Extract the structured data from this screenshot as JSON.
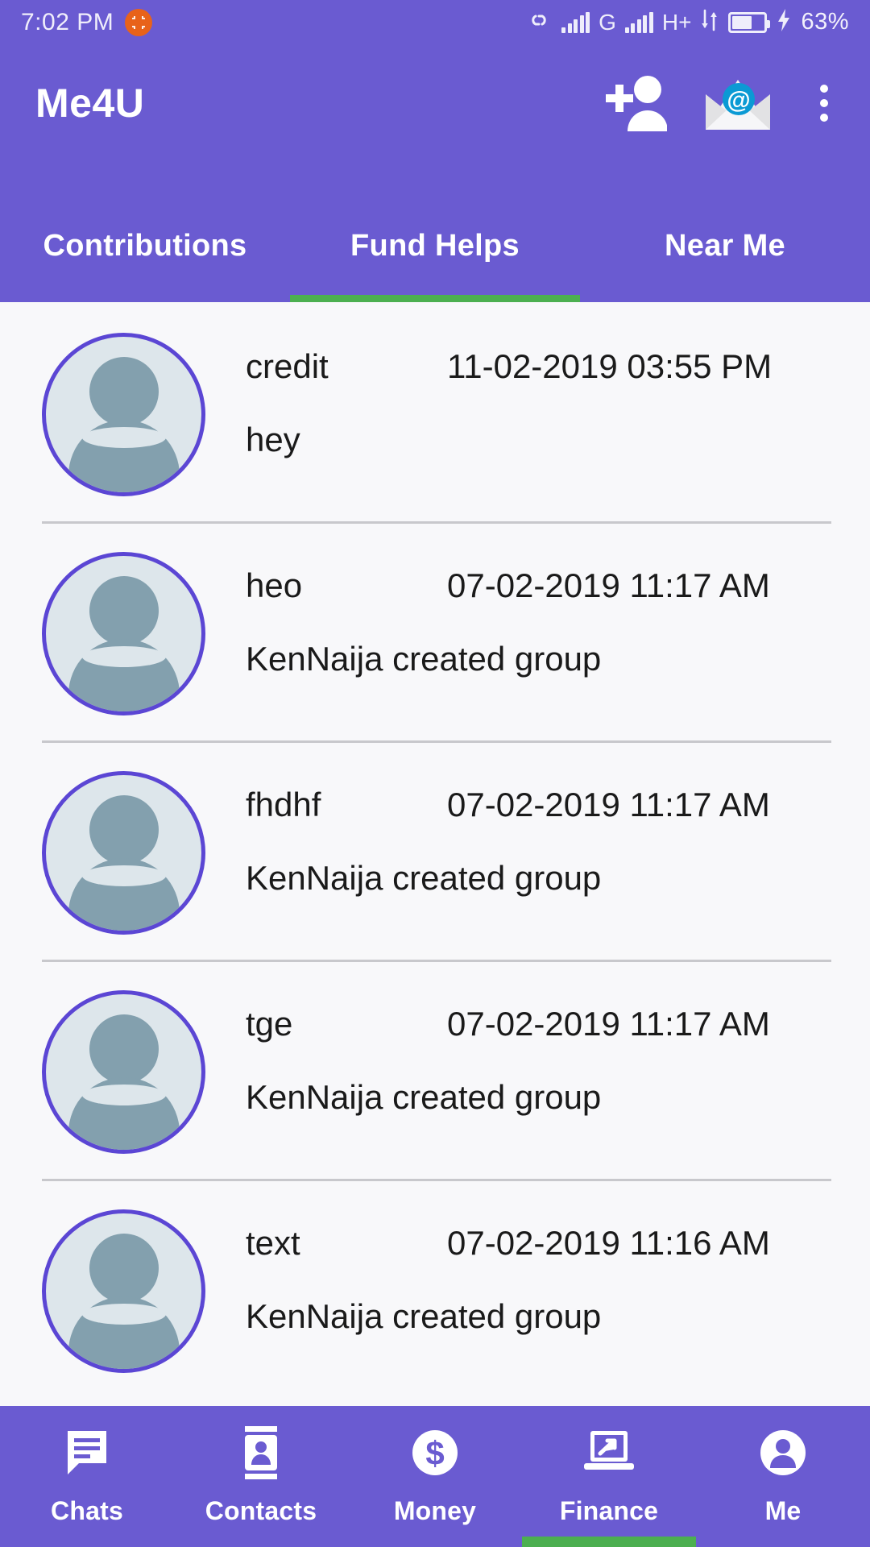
{
  "status_bar": {
    "time": "7:02 PM",
    "capture_icon": "screenshot-capture-icon",
    "link_icon": "chain-link-icon",
    "network_1_icon": "signal-bars-icon",
    "network_label_1": "G",
    "network_2_icon": "signal-bars-icon",
    "network_label_2": "H+",
    "data_transfer_icon": "data-transfer-arrows-icon",
    "battery_icon": "battery-charging-icon",
    "battery_percent": "63%",
    "accent_color": "#6a5bd1"
  },
  "app_bar": {
    "title": "Me4U",
    "add_contact_icon": "add-person-icon",
    "mail_icon": "email-envelope-icon",
    "overflow_icon": "more-vertical-icon"
  },
  "tabs": {
    "items": [
      {
        "label": "Contributions",
        "active": false
      },
      {
        "label": "Fund Helps",
        "active": true
      },
      {
        "label": "Near Me",
        "active": false
      }
    ],
    "indicator_color": "#4caf50"
  },
  "list": {
    "rows": [
      {
        "avatar_icon": "default-user-avatar-icon",
        "name": "credit",
        "timestamp": "11-02-2019 03:55 PM",
        "message": "hey"
      },
      {
        "avatar_icon": "default-user-avatar-icon",
        "name": "heo",
        "timestamp": "07-02-2019 11:17 AM",
        "message": "KenNaija created group"
      },
      {
        "avatar_icon": "default-user-avatar-icon",
        "name": "fhdhf",
        "timestamp": "07-02-2019 11:17 AM",
        "message": "KenNaija created group"
      },
      {
        "avatar_icon": "default-user-avatar-icon",
        "name": "tge",
        "timestamp": "07-02-2019 11:17 AM",
        "message": "KenNaija created group"
      },
      {
        "avatar_icon": "default-user-avatar-icon",
        "name": "text",
        "timestamp": "07-02-2019 11:16 AM",
        "message": "KenNaija created group"
      }
    ]
  },
  "bottom_nav": {
    "items": [
      {
        "label": "Chats",
        "icon": "chat-bubble-icon",
        "active": false
      },
      {
        "label": "Contacts",
        "icon": "contact-card-icon",
        "active": false
      },
      {
        "label": "Money",
        "icon": "dollar-circle-icon",
        "active": false
      },
      {
        "label": "Finance",
        "icon": "laptop-arrow-icon",
        "active": true
      },
      {
        "label": "Me",
        "icon": "person-icon",
        "active": false
      }
    ],
    "indicator_color": "#4caf50"
  }
}
